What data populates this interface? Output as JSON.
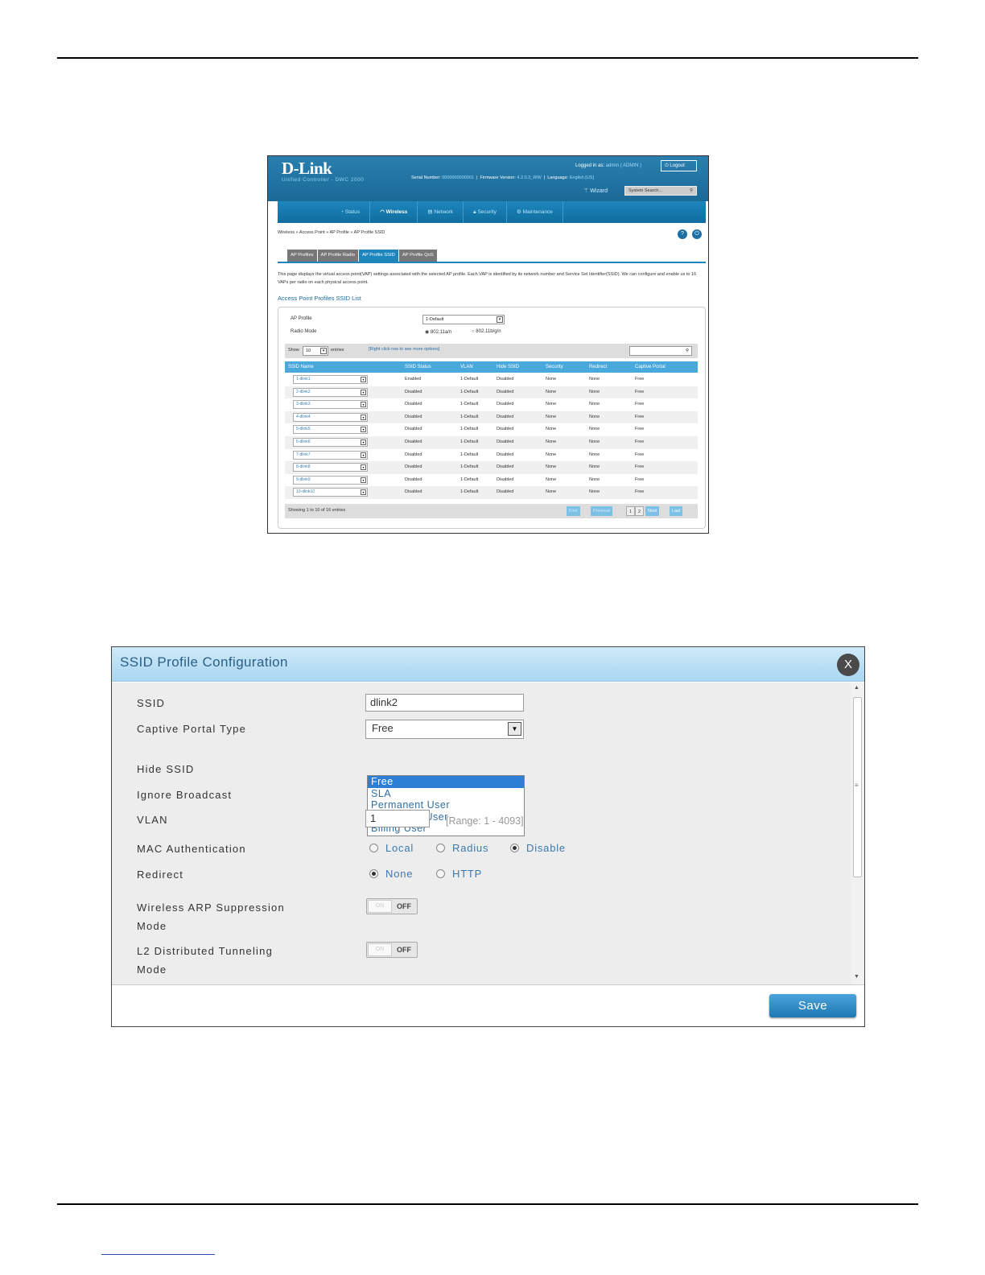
{
  "screenshot1": {
    "logo": "D-Link",
    "product": "Unified Controller - DWC 2000",
    "logged_in_label": "Logged in as:",
    "logged_in_user": "admin ( ADMIN )",
    "logout": "Logout",
    "serial_label": "Serial Number:",
    "serial_value": "0000000000001",
    "firmware_label": "Firmware Version:",
    "firmware_value": "4.2.0.3_WW",
    "language_label": "Language:",
    "language_value": "English [US]",
    "wizard": "Wizard",
    "system_search": "System Search...",
    "nav": [
      "Status",
      "Wireless",
      "Network",
      "Security",
      "Maintenance"
    ],
    "breadcrumb": "Wireless  »  Access Point  »  AP Profile  »  AP Profile SSID",
    "tabs": [
      "AP Profiles",
      "AP Profile Radio",
      "AP Profile SSID",
      "AP Profile QoS"
    ],
    "description": "This page displays the virtual access point(VAP) settings associated with the selected AP profile. Each VAP is identified by its network number and Service Set Identifier(SSID). We can configure and enable us to 16 VAPs per radio on each physical access point.",
    "list_title": "Access Point Profiles SSID List",
    "ap_profile_label": "AP Profile",
    "ap_profile_value": "1-Default",
    "radio_mode_label": "Radio Mode",
    "radio_mode_options": [
      "802.11a/n",
      "802.11b/g/n"
    ],
    "show_label": "Show",
    "show_value": "10",
    "entries_label": "entries",
    "right_click_hint": "[Right click row to see more options]",
    "columns": [
      "SSID Name",
      "SSID Status",
      "VLAN",
      "Hide SSID",
      "Security",
      "Redirect",
      "Captive Portal"
    ],
    "rows": [
      [
        "1-dlink1",
        "Enabled",
        "1-Default",
        "Disabled",
        "None",
        "None",
        "Free"
      ],
      [
        "2-dlink2",
        "Disabled",
        "1-Default",
        "Disabled",
        "None",
        "None",
        "Free"
      ],
      [
        "3-dlink3",
        "Disabled",
        "1-Default",
        "Disabled",
        "None",
        "None",
        "Free"
      ],
      [
        "4-dlink4",
        "Disabled",
        "1-Default",
        "Disabled",
        "None",
        "None",
        "Free"
      ],
      [
        "5-dlink5",
        "Disabled",
        "1-Default",
        "Disabled",
        "None",
        "None",
        "Free"
      ],
      [
        "6-dlink6",
        "Disabled",
        "1-Default",
        "Disabled",
        "None",
        "None",
        "Free"
      ],
      [
        "7-dlink7",
        "Disabled",
        "1-Default",
        "Disabled",
        "None",
        "None",
        "Free"
      ],
      [
        "8-dlink8",
        "Disabled",
        "1-Default",
        "Disabled",
        "None",
        "None",
        "Free"
      ],
      [
        "9-dlink9",
        "Disabled",
        "1-Default",
        "Disabled",
        "None",
        "None",
        "Free"
      ],
      [
        "10-dlink10",
        "Disabled",
        "1-Default",
        "Disabled",
        "None",
        "None",
        "Free"
      ]
    ],
    "showing": "Showing 1 to 10 of 16 entries",
    "pager": {
      "first": "First",
      "previous": "Previous",
      "page1": "1",
      "page2": "2",
      "next": "Next",
      "last": "Last"
    }
  },
  "dialog": {
    "title": "SSID Profile Configuration",
    "close": "X",
    "ssid_label": "SSID",
    "ssid_value": "dlink2",
    "captive_label": "Captive Portal Type",
    "captive_value": "Free",
    "captive_options": [
      "Free",
      "SLA",
      "Permanent User",
      "Temporary User",
      "Billing User"
    ],
    "hide_ssid_label": "Hide SSID",
    "ignore_broadcast_label": "Ignore Broadcast",
    "vlan_label": "VLAN",
    "vlan_value": "1",
    "vlan_range": "[Range: 1 - 4093]",
    "mac_auth_label": "MAC Authentication",
    "mac_auth_options": [
      "Local",
      "Radius",
      "Disable"
    ],
    "mac_auth_selected": "Disable",
    "redirect_label": "Redirect",
    "redirect_options": [
      "None",
      "HTTP"
    ],
    "redirect_selected": "None",
    "arp_label_1": "Wireless ARP Suppression",
    "arp_label_2": "Mode",
    "l2_label_1": "L2 Distributed Tunneling",
    "l2_label_2": "Mode",
    "toggle_on_text": "ON",
    "toggle_off_text": "OFF",
    "save": "Save"
  }
}
